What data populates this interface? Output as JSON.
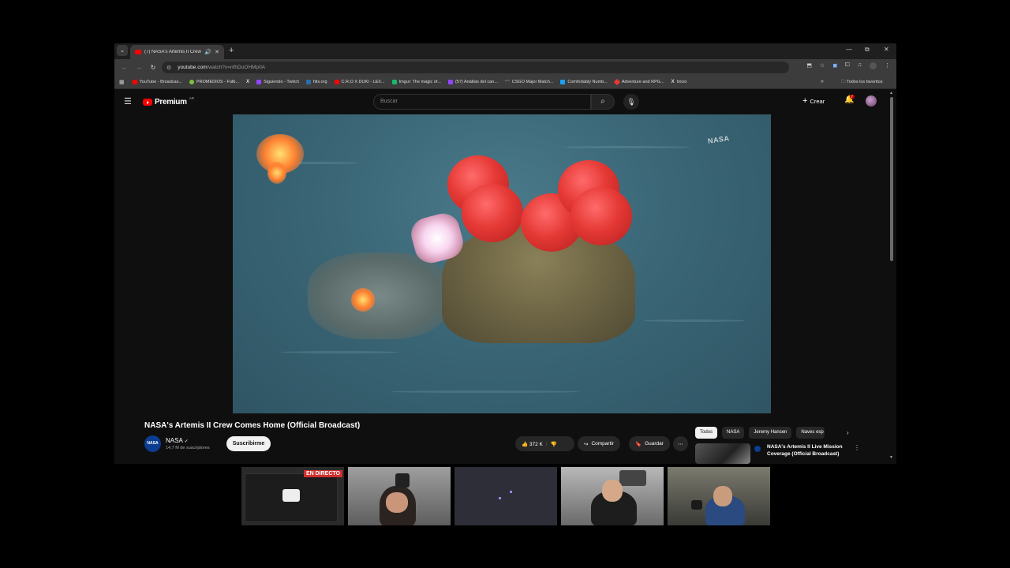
{
  "browser": {
    "tab_title": "(7) NASA's Artemis II Crew ...",
    "tab_audio_icon": "speaker-icon",
    "url_host": "youtube.com",
    "url_path": "/watch?v=nfhDuOHMp0A",
    "bookmarks": [
      {
        "label": "YouTube - Broadcas...",
        "color": "#ff0000"
      },
      {
        "label": "PROMEDIOS - Fútb...",
        "color": "#7cc142"
      },
      {
        "label": "",
        "color": "#ffffff"
      },
      {
        "label": "Siguiendo - Twitch",
        "color": "#9146ff"
      },
      {
        "label": "hltv.org",
        "color": "#2b6ea8"
      },
      {
        "label": "C.R.O X DUKI - LEX...",
        "color": "#ff0000"
      },
      {
        "label": "Imgur: The magic of...",
        "color": "#1bb76e"
      },
      {
        "label": "(57) Análisis del can...",
        "color": "#9146ff"
      },
      {
        "label": "CSGO Major Match...",
        "color": "#888888"
      },
      {
        "label": "Comfortably Numb...",
        "color": "#1da1f2"
      },
      {
        "label": "Adventure and RPG...",
        "color": "#e53935"
      },
      {
        "label": "Inicio",
        "color": "#ffffff"
      }
    ],
    "bookmarks_folder": "Todos los favoritos"
  },
  "youtube": {
    "logo_text": "Premium",
    "country": "AR",
    "search_placeholder": "Buscar",
    "create_label": "Crear",
    "notification_count": "7",
    "video_watermark": "NASA",
    "video_title": "NASA's Artemis II Crew Comes Home (Official Broadcast)",
    "channel_name": "NASA",
    "channel_avatar_text": "NASA",
    "subscribers": "14,7 M de suscriptores",
    "subscribe_label": "Suscribirme",
    "likes": "372 K",
    "share_label": "Compartir",
    "save_label": "Guardar",
    "chips": [
      "Todos",
      "NASA",
      "Jeremy Hansen",
      "Naves esp"
    ],
    "recommended_title": "NASA's Artemis II Live Mission Coverage (Official Broadcast)"
  },
  "stream": {
    "live_badge": "EN DIRECTO"
  },
  "colors": {
    "yt_red": "#ff0000",
    "live_red": "#d32f2f"
  }
}
